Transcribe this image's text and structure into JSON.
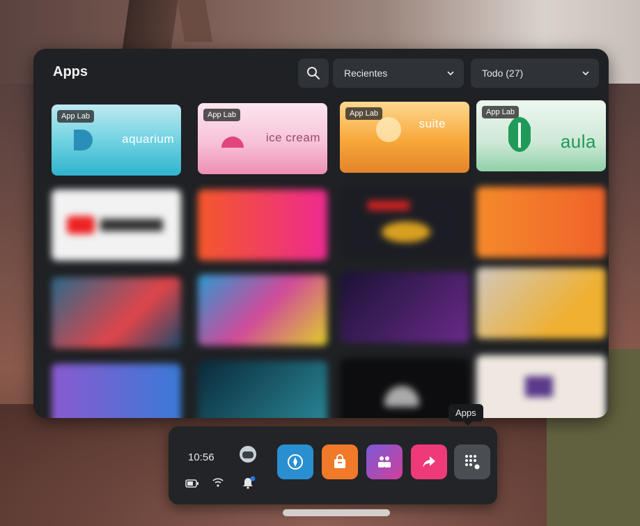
{
  "panel": {
    "title": "Apps",
    "sort_dropdown": "Recientes",
    "filter_dropdown": "Todo (27)"
  },
  "apps": [
    {
      "name": "aquarium",
      "badge": "App Lab",
      "color": "#5fc6d8"
    },
    {
      "name": "ice cream",
      "badge": "App Lab",
      "color": "#f2b8d0"
    },
    {
      "name": "suite",
      "badge": "App Lab",
      "color": "#f3a43a"
    },
    {
      "name": "aula",
      "badge": "App Lab",
      "color": "#2ea866"
    }
  ],
  "dock": {
    "time": "10:56",
    "tooltip": "Apps"
  },
  "colors": {
    "panel_bg": "#1f2124",
    "explore": "#2a8fd0",
    "store": "#f07a2a",
    "people": "#c24aa0",
    "share": "#ee3a78",
    "apps": "#4a4d52"
  }
}
